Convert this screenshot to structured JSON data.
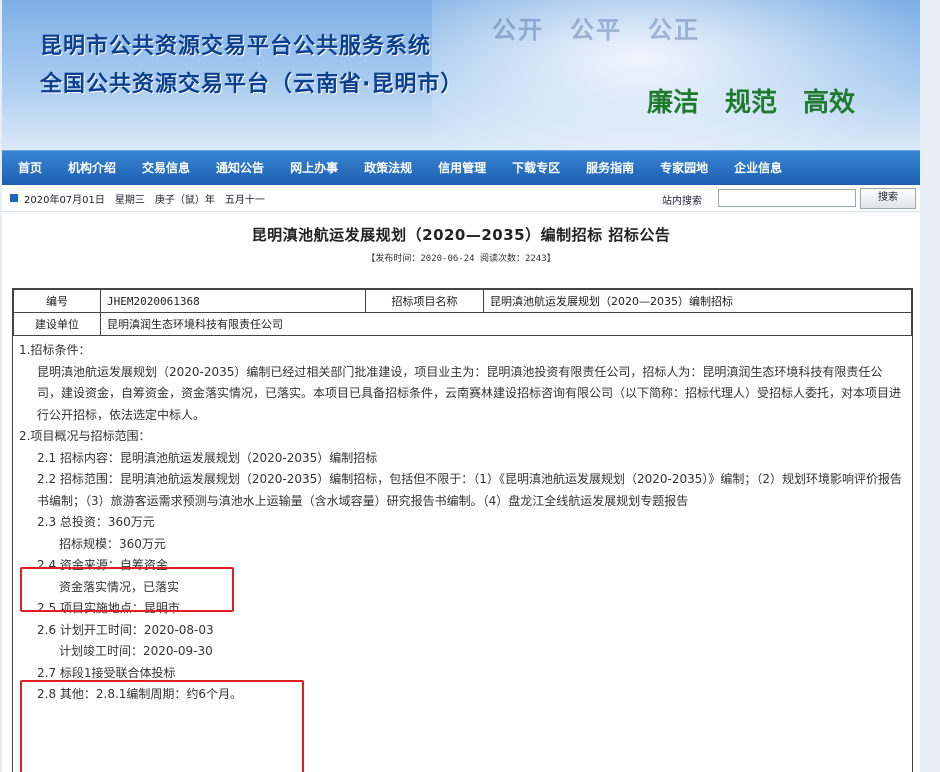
{
  "header": {
    "title_line1": "昆明市公共资源交易平台公共服务系统",
    "title_line2": "全国公共资源交易平台（云南省·昆明市）",
    "motto": "公开　公平　公正",
    "slogan": "廉洁　规范　高效"
  },
  "nav": [
    "首页",
    "机构介绍",
    "交易信息",
    "通知公告",
    "网上办事",
    "政策法规",
    "信用管理",
    "下载专区",
    "服务指南",
    "专家园地",
    "企业信息"
  ],
  "infobar": {
    "date": "2020年07月01日　星期三　庚子（鼠）年　五月十一",
    "search_label": "站内搜索",
    "search_value": "",
    "search_button": "搜索"
  },
  "article": {
    "title": "昆明滇池航运发展规划（2020—2035）编制招标 招标公告",
    "meta": "【发布时间：2020-06-24 阅读次数：2243】",
    "info_table": {
      "row1": {
        "label1": "编号",
        "value1": "JHEM2020061368",
        "label2": "招标项目名称",
        "value2": "昆明滇池航运发展规划（2020—2035）编制招标"
      },
      "row2": {
        "label1": "建设单位",
        "value1": "昆明滇润生态环境科技有限责任公司"
      }
    },
    "paragraphs": [
      {
        "indent": 0,
        "text": "1.招标条件："
      },
      {
        "indent": 1,
        "text": "昆明滇池航运发展规划（2020-2035）编制已经过相关部门批准建设，项目业主为：昆明滇池投资有限责任公司，招标人为：昆明滇润生态环境科技有限责任公司，建设资金，自筹资金，资金落实情况，已落实。本项目已具备招标条件，云南赛林建设招标咨询有限公司（以下简称：招标代理人）受招标人委托，对本项目进行公开招标，依法选定中标人。"
      },
      {
        "indent": 0,
        "text": "2.项目概况与招标范围："
      },
      {
        "indent": 1,
        "text": "2.1 招标内容：昆明滇池航运发展规划（2020-2035）编制招标"
      },
      {
        "indent": 1,
        "text": "2.2 招标范围：昆明滇池航运发展规划（2020-2035）编制招标，包括但不限于：（1）《昆明滇池航运发展规划（2020-2035）》编制；（2）规划环境影响评价报告书编制；（3）旅游客运需求预测与滇池水上运输量（含水域容量）研究报告书编制。（4）盘龙江全线航运发展规划专题报告"
      },
      {
        "indent": 1,
        "text": "2.3 总投资：360万元"
      },
      {
        "indent": 2,
        "text": "招标规模：360万元"
      },
      {
        "indent": 1,
        "text": "2.4 资金来源：自筹资金"
      },
      {
        "indent": 2,
        "text": "资金落实情况，已落实"
      },
      {
        "indent": 1,
        "text": "2.5 项目实施地点：昆明市"
      },
      {
        "indent": 1,
        "text": "2.6 计划开工时间：2020-08-03"
      },
      {
        "indent": 2,
        "text": "计划竣工时间：2020-09-30"
      },
      {
        "indent": 1,
        "text": "2.7 标段1接受联合体投标"
      },
      {
        "indent": 1,
        "text": "2.8 其他：2.8.1编制周期：约6个月。"
      }
    ]
  },
  "colors": {
    "nav_bg": "#1b5fb0",
    "title_blue": "#0c3f8e",
    "slogan_green": "#1f7a2e",
    "highlight": "#e02020"
  }
}
